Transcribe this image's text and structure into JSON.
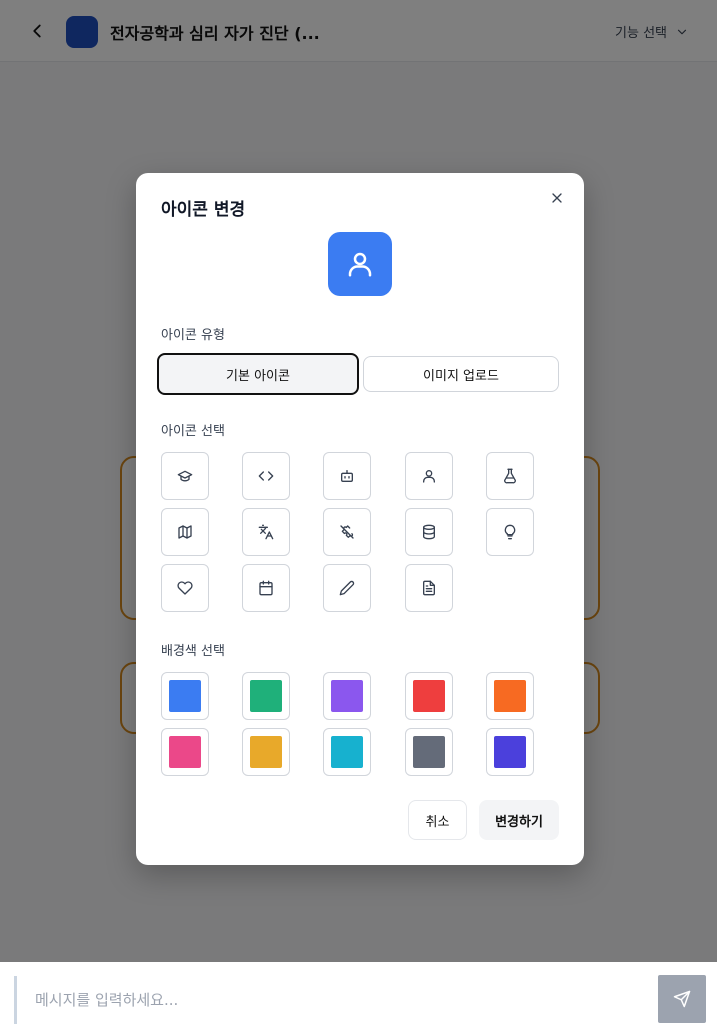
{
  "header": {
    "back_icon": "chevron-left-icon",
    "title": "전자공학과 심리 자가 진단 (...",
    "feature_select_label": "기능 선택",
    "feature_select_icon": "chevron-down-icon",
    "avatar_color": "#1f4fbf"
  },
  "composer": {
    "placeholder": "메시지를 입력하세요...",
    "send_icon": "send-icon"
  },
  "modal": {
    "title": "아이콘 변경",
    "close_icon": "close-icon",
    "preview": {
      "icon": "user-icon",
      "color": "#3b7cf2"
    },
    "type_section_label": "아이콘 유형",
    "type_options": [
      {
        "label": "기본 아이콘",
        "active": true
      },
      {
        "label": "이미지 업로드",
        "active": false
      }
    ],
    "icon_section_label": "아이콘 선택",
    "icons": [
      "graduation-cap-icon",
      "code-icon",
      "bot-icon",
      "user-icon",
      "flask-icon",
      "map-icon",
      "languages-icon",
      "puzzle-icon",
      "database-icon",
      "lightbulb-icon",
      "heart-icon",
      "calendar-icon",
      "pencil-icon",
      "file-text-icon"
    ],
    "color_section_label": "배경색 선택",
    "colors": [
      "#3b7cf2",
      "#1fb07a",
      "#8b57ee",
      "#ee3e3e",
      "#f76a22",
      "#eb4889",
      "#e8a92a",
      "#17b1cf",
      "#646b79",
      "#4b40dc"
    ],
    "cancel_label": "취소",
    "confirm_label": "변경하기"
  }
}
